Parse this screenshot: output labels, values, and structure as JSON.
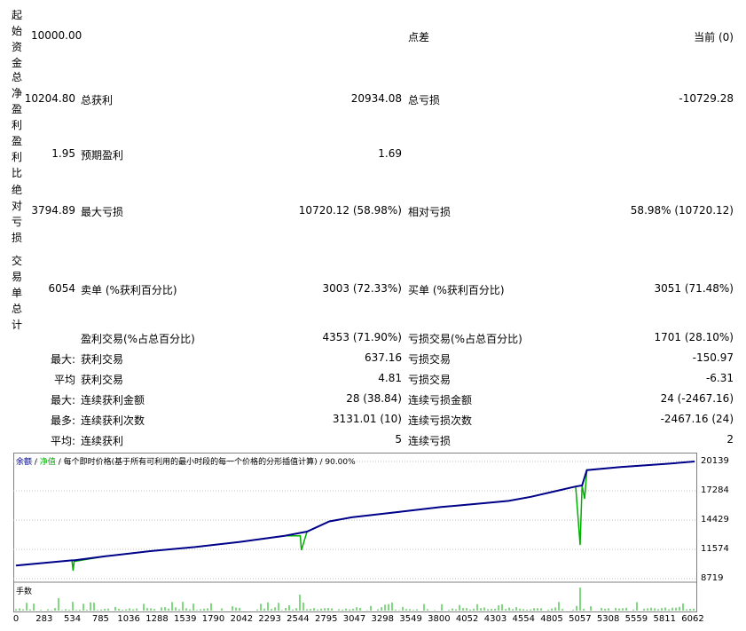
{
  "report": {
    "initial_deposit": {
      "label": "起始资金",
      "value": "10000.00",
      "spread_label": "点差",
      "spread_value": "当前 (0)"
    },
    "total_net_profit": {
      "label": "总净盈利",
      "value": "10204.80",
      "gross_profit_label": "总获利",
      "gross_profit": "20934.08",
      "gross_loss_label": "总亏损",
      "gross_loss": "-10729.28"
    },
    "profit_factor": {
      "label": "盈利比",
      "value": "1.95",
      "expected_payoff_label": "预期盈利",
      "expected_payoff": "1.69"
    },
    "absolute_drawdown": {
      "label": "绝对亏损",
      "value": "3794.89",
      "max_dd_label": "最大亏损",
      "max_dd": "10720.12 (58.98%)",
      "rel_dd_label": "相对亏损",
      "rel_dd": "58.98% (10720.12)"
    },
    "total_trades": {
      "label": "交易单总计",
      "value": "6054",
      "short_label": "卖单 (%获利百分比)",
      "short": "3003 (72.33%)",
      "long_label": "买单 (%获利百分比)",
      "long": "3051 (71.48%)"
    },
    "profit_trades": {
      "label": "盈利交易(%占总百分比)",
      "value": "4353 (71.90%)",
      "loss_label": "亏损交易(%占总百分比)",
      "loss": "1701 (28.10%)"
    },
    "largest": {
      "prefix": "最大:",
      "profit_label": "获利交易",
      "profit": "637.16",
      "loss_label": "亏损交易",
      "loss": "-150.97"
    },
    "average": {
      "prefix": "平均",
      "profit_label": "获利交易",
      "profit": "4.81",
      "loss_label": "亏损交易",
      "loss": "-6.31"
    },
    "max_consecutive": {
      "prefix": "最大:",
      "wins_label": "连续获利金额",
      "wins": "28 (38.84)",
      "losses_label": "连续亏损金额",
      "losses": "24 (-2467.16)"
    },
    "max_consecutive_amount": {
      "prefix": "最多:",
      "wins_label": "连续获利次数",
      "wins": "3131.01 (10)",
      "losses_label": "连续亏损次数",
      "losses": "-2467.16 (24)"
    },
    "average_consecutive": {
      "prefix": "平均:",
      "wins_label": "连续获利",
      "wins": "5",
      "losses_label": "连续亏损",
      "losses": "2"
    }
  },
  "chart": {
    "legend_balance": "余额",
    "legend_sep": "/",
    "legend_equity": "净值",
    "legend_rest": "/ 每个即时价格(基于所有可利用的最小时段的每一个价格的分形插值计算) / 90.00%",
    "volume_label": "手数",
    "balance_color": "#00008b",
    "equity_color": "#00b000",
    "volume_color": "#00b000",
    "y_ticks": [
      "20139",
      "17284",
      "14429",
      "11574",
      "8719"
    ],
    "x_ticks": [
      "0",
      "283",
      "534",
      "785",
      "1036",
      "1288",
      "1539",
      "1790",
      "2042",
      "2293",
      "2544",
      "2795",
      "3047",
      "3298",
      "3549",
      "3800",
      "4052",
      "4303",
      "4554",
      "4805",
      "5057",
      "5308",
      "5559",
      "5811",
      "6062"
    ]
  },
  "chart_data": {
    "type": "line",
    "ylim": [
      8719,
      20139
    ],
    "xlim": [
      0,
      6062
    ],
    "series": [
      {
        "name": "余额",
        "x": [
          0,
          500,
          520,
          800,
          1200,
          1600,
          2000,
          2400,
          2600,
          2800,
          3000,
          3400,
          3800,
          4200,
          4400,
          4600,
          4800,
          5000,
          5057,
          5100,
          5400,
          5800,
          6062
        ],
        "values": [
          10000,
          10500,
          10500,
          10900,
          11400,
          11800,
          12300,
          12900,
          13300,
          14300,
          14700,
          15200,
          15700,
          16100,
          16300,
          16700,
          17200,
          17700,
          17800,
          19300,
          19600,
          19900,
          20139
        ]
      },
      {
        "name": "净值",
        "x": [
          0,
          500,
          510,
          520,
          800,
          1200,
          1600,
          2000,
          2400,
          2540,
          2550,
          2600,
          2800,
          3000,
          3400,
          3800,
          4200,
          4400,
          4600,
          4800,
          5000,
          5040,
          5057,
          5080,
          5100,
          5400,
          5800,
          6062
        ],
        "values": [
          10000,
          10500,
          9500,
          10400,
          10900,
          11400,
          11800,
          12300,
          12900,
          12900,
          11500,
          13300,
          14300,
          14700,
          15200,
          15700,
          16100,
          16300,
          16700,
          17200,
          17700,
          12000,
          17800,
          16500,
          19300,
          19600,
          19900,
          20139
        ]
      }
    ]
  }
}
